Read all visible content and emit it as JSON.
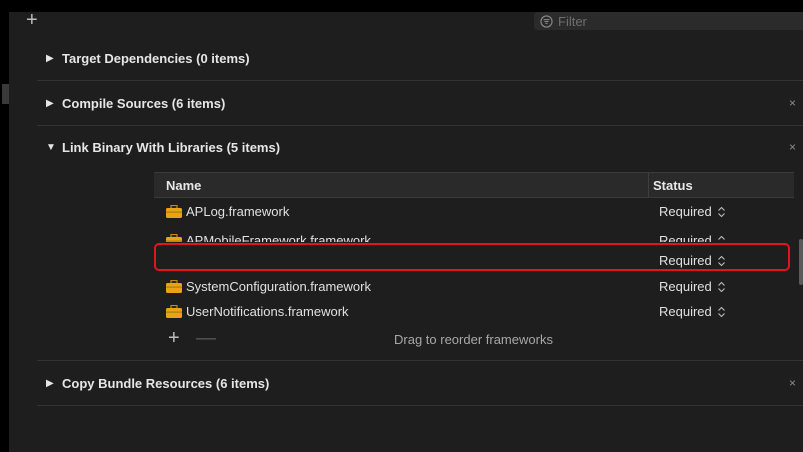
{
  "toolbar": {
    "add_symbol": "+",
    "filter_placeholder": "Filter"
  },
  "sections": {
    "target_dependencies": {
      "title": "Target Dependencies (0 items)",
      "disclosure": "▶"
    },
    "compile_sources": {
      "title": "Compile Sources (6 items)",
      "disclosure": "▶",
      "close": "×"
    },
    "link_binary": {
      "title": "Link Binary With Libraries (5 items)",
      "disclosure": "▼",
      "close": "×"
    },
    "copy_bundle": {
      "title": "Copy Bundle Resources (6 items)",
      "disclosure": "▶",
      "close": "×"
    }
  },
  "library_table": {
    "columns": {
      "name": "Name",
      "status": "Status"
    },
    "rows": [
      {
        "name": "APLog.framework",
        "status": "Required",
        "icon": "toolbox-icon"
      },
      {
        "name": "APMobileFramework.framework",
        "status": "Required",
        "icon": "toolbox-icon"
      },
      {
        "name": "",
        "status": "Required",
        "icon": ""
      },
      {
        "name": "SystemConfiguration.framework",
        "status": "Required",
        "icon": "toolbox-icon"
      },
      {
        "name": "UserNotifications.framework",
        "status": "Required",
        "icon": "toolbox-icon"
      }
    ],
    "footer": {
      "add": "+",
      "remove": "—",
      "hint": "Drag to reorder frameworks"
    }
  },
  "colors": {
    "background": "#1e1e1e",
    "highlight": "#e0151d",
    "header_bg": "#2a2a2a",
    "toolbox": "#e8a417"
  }
}
